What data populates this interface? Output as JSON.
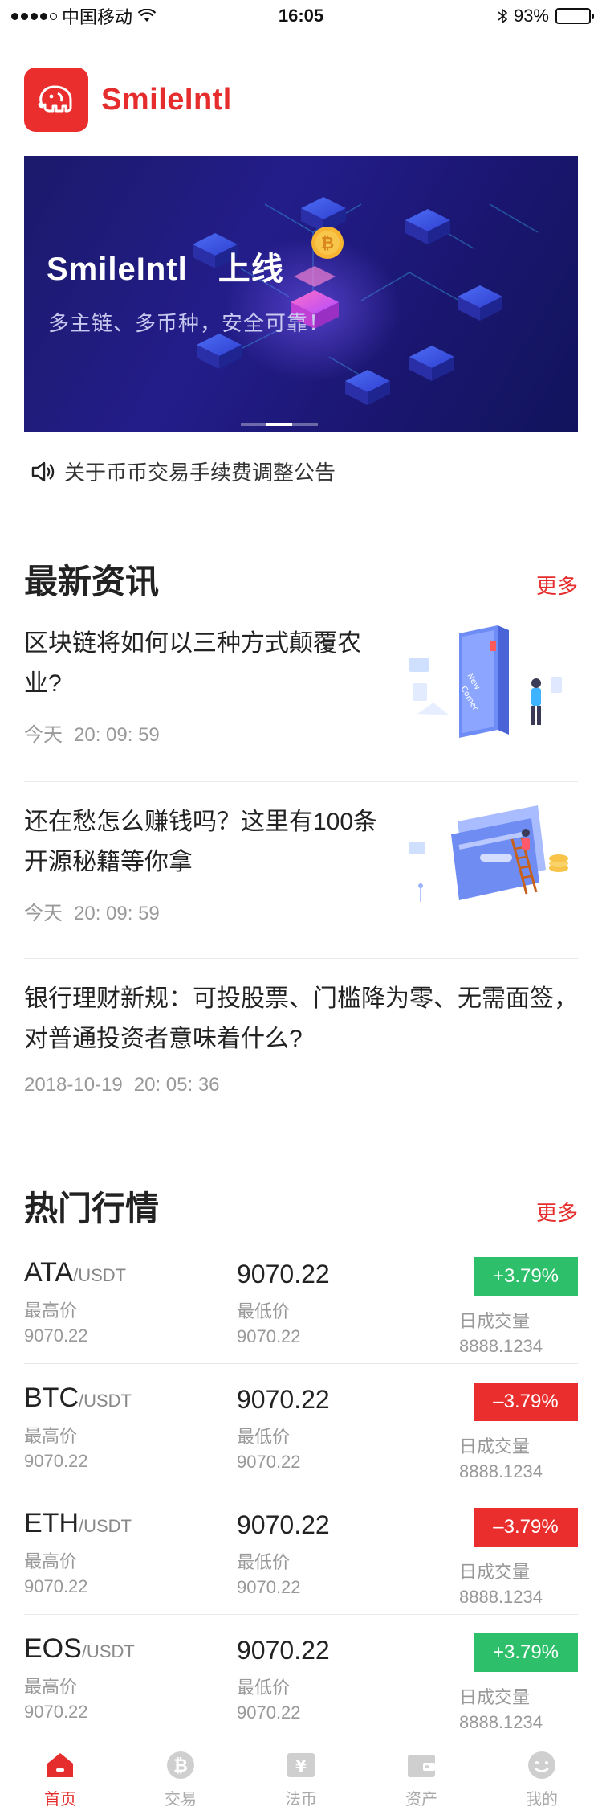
{
  "status_bar": {
    "carrier": "中国移动",
    "time": "16:05",
    "battery": "93%",
    "battery_level": 0.93
  },
  "app": {
    "name": "SmileIntl",
    "brand_color": "#e62d2d"
  },
  "banner": {
    "title_a": "SmileIntl",
    "title_b": "上线",
    "subtitle": "多主链、多币种，安全可靠！",
    "slide_count": 3,
    "active_slide": 1
  },
  "notice": {
    "text": "关于币币交易手续费调整公告"
  },
  "news": {
    "title": "最新资讯",
    "more": "更多",
    "items": [
      {
        "title": "区块链将如何以三种方式颠覆农业?",
        "date": "今天",
        "time": "20: 09: 59",
        "has_image": true
      },
      {
        "title": "还在愁怎么赚钱吗？这里有100条开源秘籍等你拿",
        "date": "今天",
        "time": "20: 09: 59",
        "has_image": true
      },
      {
        "title": "银行理财新规：可投股票、门槛降为零、无需面签，对普通投资者意味着什么?",
        "date": "2018-10-19",
        "time": "20: 05: 36",
        "has_image": false
      }
    ]
  },
  "market": {
    "title": "热门行情",
    "more": "更多",
    "labels": {
      "high": "最高价",
      "low": "最低价",
      "volume": "日成交量"
    },
    "rows": [
      {
        "base": "ATA",
        "quote": "/USDT",
        "price": "9070.22",
        "high": "9070.22",
        "low": "9070.22",
        "change": "+3.79%",
        "direction": "up",
        "volume": "8888.1234"
      },
      {
        "base": "BTC",
        "quote": "/USDT",
        "price": "9070.22",
        "high": "9070.22",
        "low": "9070.22",
        "change": "–3.79%",
        "direction": "down",
        "volume": "8888.1234"
      },
      {
        "base": "ETH",
        "quote": "/USDT",
        "price": "9070.22",
        "high": "9070.22",
        "low": "9070.22",
        "change": "–3.79%",
        "direction": "down",
        "volume": "8888.1234"
      },
      {
        "base": "EOS",
        "quote": "/USDT",
        "price": "9070.22",
        "high": "9070.22",
        "low": "9070.22",
        "change": "+3.79%",
        "direction": "up",
        "volume": "8888.1234"
      }
    ]
  },
  "colors": {
    "up": "#2dbf6a",
    "down": "#ea2e2e"
  },
  "bottom_nav": {
    "items": [
      {
        "label": "首页",
        "icon": "home-icon",
        "active": true
      },
      {
        "label": "交易",
        "icon": "bitcoin-icon",
        "active": false
      },
      {
        "label": "法币",
        "icon": "yuan-icon",
        "active": false
      },
      {
        "label": "资产",
        "icon": "wallet-icon",
        "active": false
      },
      {
        "label": "我的",
        "icon": "profile-icon",
        "active": false
      }
    ]
  }
}
